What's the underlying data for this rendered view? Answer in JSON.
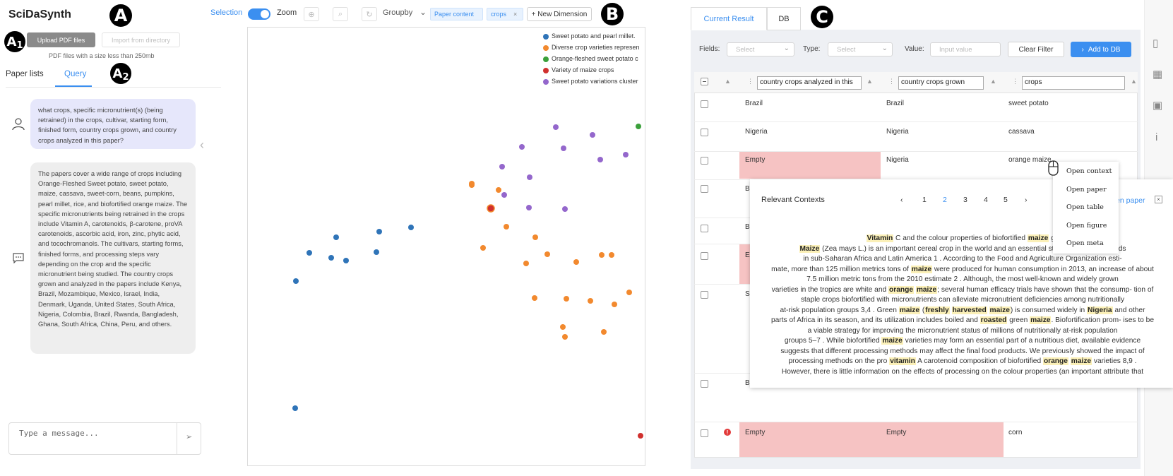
{
  "badges": {
    "a": "A",
    "a1": "A",
    "a1_sub": "1",
    "a2": "A",
    "a2_sub": "2",
    "b": "B",
    "c": "C"
  },
  "panel_a": {
    "app_title": "SciDaSynth",
    "upload_button": "Upload PDF files",
    "import_button": "Import from directory",
    "pdf_note": "PDF files with a size less than 250mb",
    "tabs": [
      "Paper lists",
      "Query"
    ],
    "question": "what crops, specific micronutrient(s) (being retrained) in the crops, cultivar, starting form, finished form, country crops grown, and country crops analyzed in this paper?",
    "answer": "The papers cover a wide range of crops including Orange-Fleshed Sweet potato, sweet potato, maize, cassava, sweet-corn, beans, pumpkins, pearl millet, rice, and biofortified orange maize. The specific micronutrients being retrained in the crops include Vitamin A, carotenoids, β-carotene, proVA carotenoids, ascorbic acid, iron, zinc, phytic acid, and tocochromanols. The cultivars, starting forms, finished forms, and processing steps vary depending on the crop and the specific micronutrient being studied. The country crops grown and analyzed in the papers include Kenya, Brazil, Mozambique, Mexico, Israel, India, Denmark, Uganda, United States, South Africa, Nigeria, Colombia, Brazil, Rwanda, Bangladesh, Ghana, South Africa, China, Peru, and others.",
    "message_placeholder": "Type a message...",
    "icons": {
      "user": "user-icon",
      "bot": "chat-icon",
      "send": "send-icon",
      "collapse": "chevron-left-icon"
    }
  },
  "panel_b": {
    "selection_label": "Selection",
    "zoom_label": "Zoom",
    "groupby_label": "Groupby",
    "tags": [
      "Paper content",
      "crops"
    ],
    "new_dimension": "+ New Dimension",
    "legend": [
      {
        "label": "Sweet potato and pearl millet.",
        "color": "#2f74b8"
      },
      {
        "label": "Diverse crop varieties represen",
        "color": "#f2892e"
      },
      {
        "label": "Orange-fleshed sweet potato c",
        "color": "#3ba03b"
      },
      {
        "label": "Variety of maize crops",
        "color": "#d0302e"
      },
      {
        "label": "Sweet potato variations cluster",
        "color": "#9467cc"
      }
    ]
  },
  "chart_data": {
    "type": "scatter",
    "title": "",
    "xlabel": "",
    "ylabel": "",
    "grid": false,
    "legend_position": "top-right",
    "series": [
      {
        "name": "Sweet potato and pearl millet.",
        "points": [
          [
            126,
            298
          ],
          [
            187,
            290
          ],
          [
            232,
            284
          ],
          [
            88,
            320
          ],
          [
            140,
            331
          ],
          [
            183,
            319
          ],
          [
            69,
            360
          ],
          [
            119,
            327
          ],
          [
            68,
            540
          ]
        ]
      },
      {
        "name": "Diverse crop varieties represen",
        "points": [
          [
            318,
            222
          ],
          [
            356,
            231
          ],
          [
            318,
            224
          ],
          [
            367,
            283
          ],
          [
            408,
            298
          ],
          [
            334,
            313
          ],
          [
            425,
            322
          ],
          [
            395,
            335
          ],
          [
            516,
            323
          ],
          [
            502,
            323
          ],
          [
            466,
            333
          ],
          [
            541,
            376
          ],
          [
            452,
            385
          ],
          [
            407,
            384
          ],
          [
            486,
            388
          ],
          [
            520,
            393
          ],
          [
            447,
            425
          ],
          [
            505,
            432
          ],
          [
            450,
            439
          ]
        ]
      },
      {
        "name": "Orange-fleshed sweet potato c",
        "points": [
          [
            594,
            49
          ],
          [
            646,
            62
          ],
          [
            660,
            100
          ],
          [
            554,
            141
          ]
        ]
      },
      {
        "name": "Variety of maize crops",
        "points": [
          [
            695,
            296
          ],
          [
            665,
            458
          ],
          [
            660,
            486
          ],
          [
            638,
            505
          ],
          [
            586,
            527
          ],
          [
            557,
            579
          ],
          [
            678,
            613
          ],
          [
            638,
            650
          ]
        ]
      },
      {
        "name": "Sweet potato variations cluster",
        "points": [
          [
            437,
            142
          ],
          [
            389,
            170
          ],
          [
            448,
            172
          ],
          [
            361,
            198
          ],
          [
            489,
            153
          ],
          [
            500,
            188
          ],
          [
            400,
            213
          ],
          [
            536,
            181
          ],
          [
            364,
            238
          ],
          [
            399,
            256
          ],
          [
            450,
            258
          ]
        ]
      }
    ]
  },
  "panel_c": {
    "tabs": [
      "Current Result",
      "DB"
    ],
    "filters": {
      "fields_label": "Fields:",
      "fields_placeholder": "Select",
      "type_label": "Type:",
      "type_placeholder": "Select",
      "value_label": "Value:",
      "value_placeholder": "Input value",
      "clear": "Clear Filter",
      "add": "Add to DB"
    },
    "columns": [
      "country crops analyzed in this",
      "country crops grown",
      "crops"
    ],
    "rows": [
      [
        "Brazil",
        "Brazil",
        "sweet potato"
      ],
      [
        "Nigeria",
        "Nigeria",
        "cassava"
      ],
      [
        "Empty",
        "Nigeria",
        "orange maize"
      ],
      [
        "B",
        "",
        ""
      ],
      [
        "B",
        "",
        ""
      ],
      [
        "E",
        "",
        ""
      ],
      [
        "Sc",
        "",
        ""
      ],
      [
        "B",
        "",
        ""
      ],
      [
        "Empty",
        "Empty",
        "corn"
      ]
    ],
    "warn_icon": "!",
    "menu": [
      "Open context",
      "Open paper",
      "Open table",
      "Open figure",
      "Open meta"
    ],
    "context": {
      "title": "Relevant Contexts",
      "pages": [
        "1",
        "2",
        "3",
        "4",
        "5"
      ],
      "current_page": "2",
      "open_paper": "Open paper",
      "close": "×",
      "lines": [
        "Vitamin C and the colour properties of biofortified maize ge",
        "Maize (Zea mays L.) is an important cereal crop in the world and an essential staple in t of households",
        "in sub-Saharan Africa and Latin America 1 . According to the Food and Agriculture Organization esti-",
        "mate, more than 125 million metrics tons of maize were produced for human consumption in 2013, an increase of about",
        "7.5 million metric tons from the 2010 estimate 2 . Although, the most well-known and widely grown",
        "varieties in the tropics are white and orange maize; several human efficacy trials have shown that the consump- tion of",
        "staple crops biofortified with micronutrients can alleviate micronutrient deficiencies among nutritionally",
        "at-risk population groups 3,4 . Green maize (freshly harvested maize) is consumed widely in Nigeria and other",
        "parts of Africa in its season, and its utilization includes boiled and roasted green maize. Biofortification prom- ises to be",
        "a viable strategy for improving the micronutrient status of millions of nutritionally at-risk population",
        "groups 5–7 . While biofortified maize varieties may form an essential part of a nutritious diet, available evidence",
        "suggests that different processing methods may affect the final food products. We previously showed the impact of",
        "processing methods on the pro vitamin A carotenoid composition of biofortified orange maize varieties 8,9 .",
        "However, there is little information on the effects of processing on the colour properties (an important attribute that"
      ],
      "highlight_terms": [
        "Vitamin",
        "maize",
        "Maize",
        "orange",
        "freshly",
        "harvested",
        "Nigeria",
        "roasted",
        "vitamin"
      ]
    }
  }
}
